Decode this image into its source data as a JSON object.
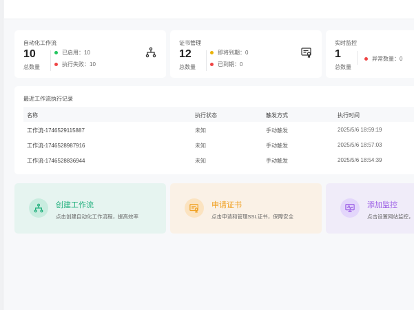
{
  "stats": [
    {
      "title": "自动化工作流",
      "value": "10",
      "count_label": "总数量",
      "items": [
        {
          "label": "已启用：10",
          "color": "#22c55e"
        },
        {
          "label": "执行失败：10",
          "color": "#ef4444"
        }
      ],
      "icon": "workflow-icon"
    },
    {
      "title": "证书管理",
      "value": "12",
      "count_label": "总数量",
      "items": [
        {
          "label": "即将到期：0",
          "color": "#eab308"
        },
        {
          "label": "已到期：0",
          "color": "#ef4444"
        }
      ],
      "icon": "certificate-icon"
    },
    {
      "title": "实时监控",
      "value": "1",
      "count_label": "总数量",
      "items": [
        {
          "label": "异常数量：0",
          "color": "#ef4444"
        }
      ]
    }
  ],
  "table": {
    "caption": "最近工作流执行记录",
    "headers": [
      "名称",
      "执行状态",
      "触发方式",
      "执行时间"
    ],
    "rows": [
      [
        "工作流-1746529115887",
        "未知",
        "手动触发",
        "2025/5/6 18:59:19"
      ],
      [
        "工作流-1746528987916",
        "未知",
        "手动触发",
        "2025/5/6 18:57:03"
      ],
      [
        "工作流-1746528836944",
        "未知",
        "手动触发",
        "2025/5/6 18:54:39"
      ]
    ]
  },
  "actions": [
    {
      "title": "创建工作流",
      "desc": "点击创建自动化工作流程，提高效率",
      "color": "#22b07d",
      "bg": "#e6f4f0",
      "circle": "#c8ecdf"
    },
    {
      "title": "申请证书",
      "desc": "点击申请和管理SSL证书，保障安全",
      "color": "#f0a020",
      "bg": "#faf1e6",
      "circle": "#fbe3c0"
    },
    {
      "title": "添加监控",
      "desc": "点击设置网站监控，",
      "color": "#9b5de5",
      "bg": "#f0ecf9",
      "circle": "#e3d6fb"
    }
  ]
}
